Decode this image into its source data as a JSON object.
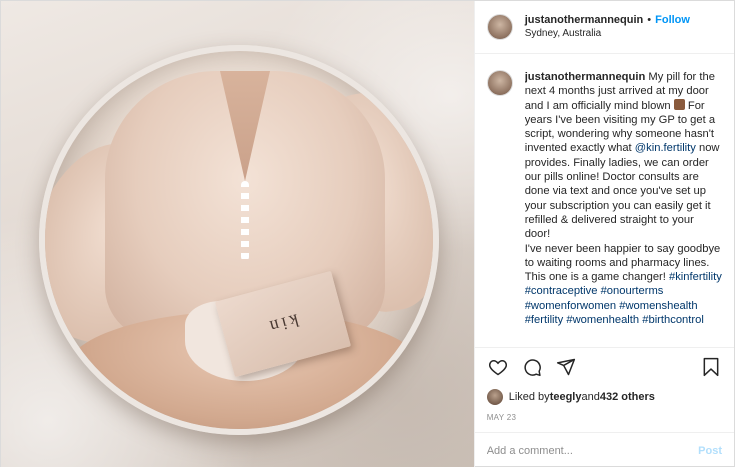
{
  "post": {
    "image_alt": "Woman holding kin box reflected in round mirror",
    "box_logo": "kin"
  },
  "header": {
    "username": "justanothermannequin",
    "separator": "•",
    "follow_label": "Follow",
    "location": "Sydney, Australia"
  },
  "caption": {
    "username": "justanothermannequin",
    "part1": " My pill for the next 4 months just arrived at my door and I am officially mind blown ",
    "part2": " For years I've been visiting my GP to get a script, wondering why someone hasn't invented exactly what ",
    "mention": "@kin.fertility",
    "part3": " now provides. Finally ladies, we can order our pills online! Doctor consults are done via text and once you've set up your subscription you can easily get it refilled & delivered straight to your door!",
    "part4": "I've never been happier to say goodbye to waiting rooms and pharmacy lines. This one is a game changer! ",
    "hashtags": [
      "#kinfertility",
      "#contraceptive",
      "#onourterms",
      "#womenforwomen",
      "#womenshealth",
      "#fertility",
      "#womenhealth",
      "#birthcontrol"
    ]
  },
  "actions": {
    "like_icon": "heart-icon",
    "comment_icon": "comment-icon",
    "share_icon": "share-icon",
    "save_icon": "bookmark-icon"
  },
  "likes": {
    "prefix": "Liked by ",
    "user": "teegly",
    "middle": " and ",
    "others": "432 others"
  },
  "date": "MAY 23",
  "comment_box": {
    "placeholder": "Add a comment...",
    "post_label": "Post"
  }
}
